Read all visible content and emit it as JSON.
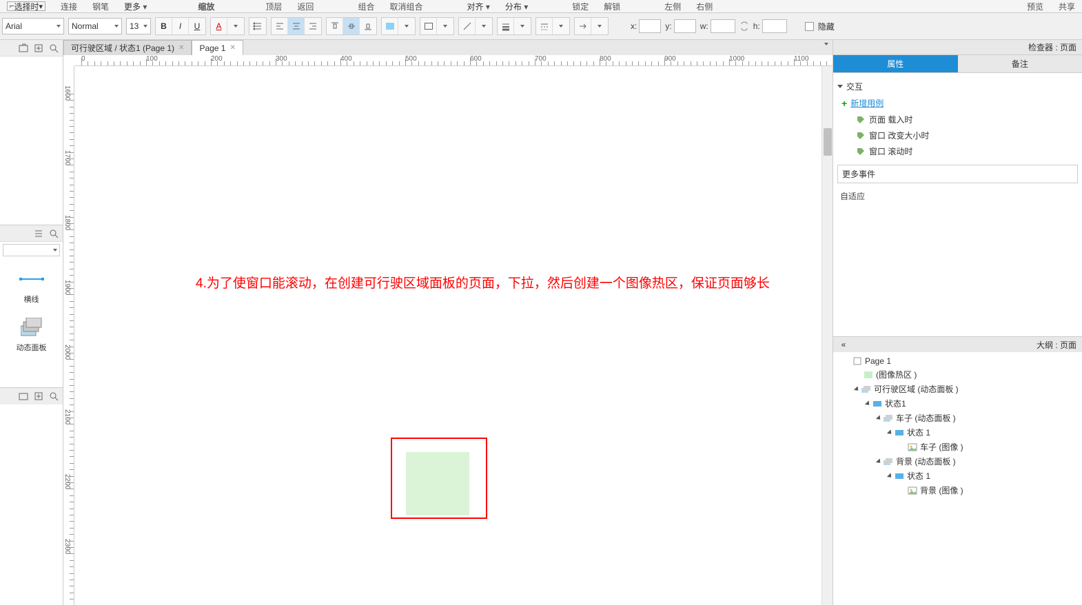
{
  "topbar": {
    "select_mode": "选择时",
    "items": [
      "连接",
      "钢笔",
      "更多"
    ],
    "items2": [
      "缩放"
    ],
    "items3": [
      "顶层",
      "返回"
    ],
    "items4": [
      "组合",
      "取消组合"
    ],
    "items5": [
      "对齐",
      "分布"
    ],
    "items6": [
      "锁定",
      "解锁"
    ],
    "items7": [
      "左侧",
      "右侧"
    ],
    "right": [
      "预览",
      "共享"
    ]
  },
  "format": {
    "font": "Arial",
    "weight": "Normal",
    "size": "13",
    "coords": {
      "x": "",
      "y": "",
      "w": "",
      "h": ""
    },
    "hide": "隐藏"
  },
  "tabs": [
    {
      "label": "可行驶区域 / 状态1  (Page 1)",
      "active": false
    },
    {
      "label": "Page 1",
      "active": true
    }
  ],
  "ruler_h": [
    0,
    100,
    200,
    300,
    400,
    500,
    600,
    700,
    800,
    900,
    1000,
    1100
  ],
  "ruler_v": [
    1600,
    1700,
    1800,
    1900,
    2000,
    2100,
    2200,
    2300
  ],
  "widgets": {
    "hr": "横线",
    "dp": "动态面板"
  },
  "canvas": {
    "red_text": "4.为了使窗口能滚动，在创建可行驶区域面板的页面，下拉，然后创建一个图像热区，保证页面够长"
  },
  "inspector": {
    "title": "检查器 : 页面",
    "tabs": {
      "prop": "属性",
      "notes": "备注"
    },
    "interaction": {
      "hdr": "交互",
      "add": "新增用例",
      "events": [
        "页面 载入时",
        "窗口 改变大小时",
        "窗口 滚动时"
      ],
      "more": "更多事件"
    },
    "adapt": "自适应"
  },
  "outline": {
    "title": "大纲 : 页面",
    "tree": [
      {
        "d": 0,
        "tog": false,
        "ic": "page",
        "t": "Page 1"
      },
      {
        "d": 1,
        "tog": false,
        "ic": "hot",
        "t": "(图像热区 )"
      },
      {
        "d": 1,
        "tog": true,
        "ic": "dp",
        "t": "可行驶区域 (动态面板 )"
      },
      {
        "d": 2,
        "tog": true,
        "ic": "state",
        "t": "状态1"
      },
      {
        "d": 3,
        "tog": true,
        "ic": "dp",
        "t": "车子 (动态面板 )"
      },
      {
        "d": 4,
        "tog": true,
        "ic": "state",
        "t": "状态 1"
      },
      {
        "d": 5,
        "tog": false,
        "ic": "img",
        "t": "车子 (图像 )"
      },
      {
        "d": 3,
        "tog": true,
        "ic": "dp",
        "t": "背景 (动态面板 )"
      },
      {
        "d": 4,
        "tog": true,
        "ic": "state",
        "t": "状态 1"
      },
      {
        "d": 5,
        "tog": false,
        "ic": "img",
        "t": "背景 (图像 )"
      }
    ]
  }
}
